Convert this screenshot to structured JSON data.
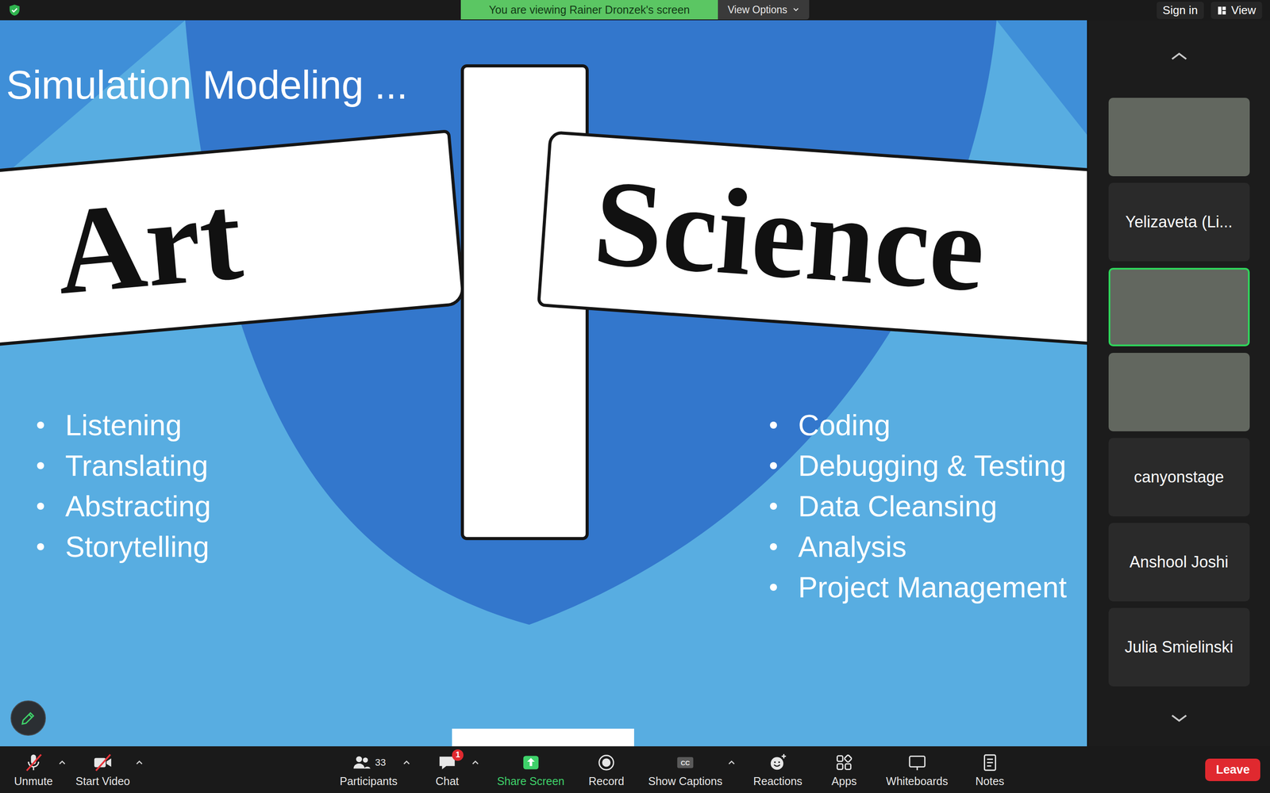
{
  "banner": {
    "text": "You are viewing Rainer Dronzek's screen",
    "options": "View Options"
  },
  "top_right": {
    "sign_in": "Sign in",
    "view": "View"
  },
  "slide": {
    "title": "Simulation Modeling ...",
    "signs": [
      {
        "label": "Art"
      },
      {
        "label": "Science"
      }
    ],
    "columns": [
      {
        "items": [
          "Listening",
          "Translating",
          "Abstracting",
          "Storytelling"
        ]
      },
      {
        "items": [
          "Coding",
          "Debugging & Testing",
          "Data Cleansing",
          "Analysis",
          "Project Management"
        ]
      }
    ]
  },
  "gallery": {
    "tiles": [
      {
        "kind": "video",
        "active": false
      },
      {
        "kind": "name",
        "name": "Yelizaveta (Li...",
        "active": false
      },
      {
        "kind": "video",
        "active": true
      },
      {
        "kind": "video",
        "active": false
      },
      {
        "kind": "name",
        "name": "canyonstage",
        "active": false
      },
      {
        "kind": "name",
        "name": "Anshool Joshi",
        "active": false
      },
      {
        "kind": "name",
        "name": "Julia Smielinski",
        "active": false
      }
    ]
  },
  "toolbar": {
    "left_items": [
      {
        "label": "Unmute",
        "kind": "mic",
        "off": true,
        "caret": true,
        "color": "#e6e6e6"
      },
      {
        "label": "Start Video",
        "kind": "video",
        "off": true,
        "caret": true,
        "color": "#e6e6e6"
      }
    ],
    "center_items": [
      {
        "label": "Participants",
        "kind": "participants",
        "count": "33",
        "off": false,
        "caret": true,
        "color": "#e6e6e6"
      },
      {
        "label": "Chat",
        "kind": "chat",
        "badge": "1",
        "off": false,
        "caret": true,
        "color": "#e6e6e6"
      },
      {
        "label": "Share Screen",
        "kind": "share",
        "off": false,
        "caret": false,
        "color": "#3fd16a"
      },
      {
        "label": "Record",
        "kind": "record",
        "off": false,
        "caret": false,
        "color": "#e6e6e6"
      },
      {
        "label": "Show Captions",
        "kind": "captions",
        "icon_text": "CC",
        "off": false,
        "caret": true,
        "color": "#e6e6e6"
      },
      {
        "label": "Reactions",
        "kind": "reactions",
        "off": false,
        "caret": false,
        "color": "#e6e6e6"
      },
      {
        "label": "Apps",
        "kind": "apps",
        "off": false,
        "caret": false,
        "color": "#e6e6e6"
      },
      {
        "label": "Whiteboards",
        "kind": "whiteboards",
        "off": false,
        "caret": false,
        "color": "#e6e6e6"
      },
      {
        "label": "Notes",
        "kind": "notes",
        "off": false,
        "caret": false,
        "color": "#e6e6e6"
      }
    ],
    "leave": "Leave"
  }
}
